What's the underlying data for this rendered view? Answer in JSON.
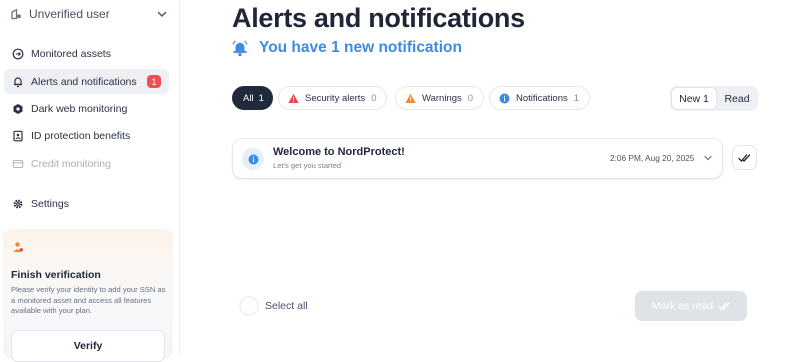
{
  "sidebar": {
    "user": {
      "label": "Unverified user",
      "icon": "unverified-user-icon"
    },
    "items": [
      {
        "label": "Monitored assets",
        "icon": "monitored-assets-icon",
        "state": "normal"
      },
      {
        "label": "Alerts and notifications",
        "icon": "alert-bell-icon",
        "state": "active",
        "badge": "1"
      },
      {
        "label": "Dark web monitoring",
        "icon": "dark-web-icon",
        "state": "normal"
      },
      {
        "label": "ID protection benefits",
        "icon": "id-protection-icon",
        "state": "normal"
      },
      {
        "label": "Credit monitoring",
        "icon": "credit-card-icon",
        "state": "disabled"
      },
      {
        "label": "Settings",
        "icon": "gear-icon",
        "state": "normal"
      }
    ],
    "verification": {
      "title": "Finish verification",
      "text": "Please verify your identity to add your SSN as a monitored asset and access all features available with your plan.",
      "button": "Verify"
    }
  },
  "main": {
    "title": "Alerts and notifications",
    "subtitle": "You have 1 new notification",
    "filters": [
      {
        "label": "All",
        "count": "1",
        "active": true
      },
      {
        "label": "Security alerts",
        "count": "0",
        "icon": "red-warning-icon"
      },
      {
        "label": "Warnings",
        "count": "0",
        "icon": "orange-warning-icon"
      },
      {
        "label": "Notifications",
        "count": "1",
        "icon": "info-icon"
      }
    ],
    "toggle": {
      "new": "New 1",
      "read": "Read"
    },
    "notification": {
      "title": "Welcome to NordProtect!",
      "subtitle": "Let's get you started",
      "time": "2:06 PM, Aug 20, 2025"
    },
    "footer": {
      "select_all": "Select all",
      "mark_as_read": "Mark as read"
    }
  },
  "colors": {
    "accent_blue": "#3f8be0",
    "active_pill": "#1f2a3b",
    "badge_red": "#f24f55",
    "warning_red": "#e5484d",
    "warning_orange": "#f08a2c"
  }
}
